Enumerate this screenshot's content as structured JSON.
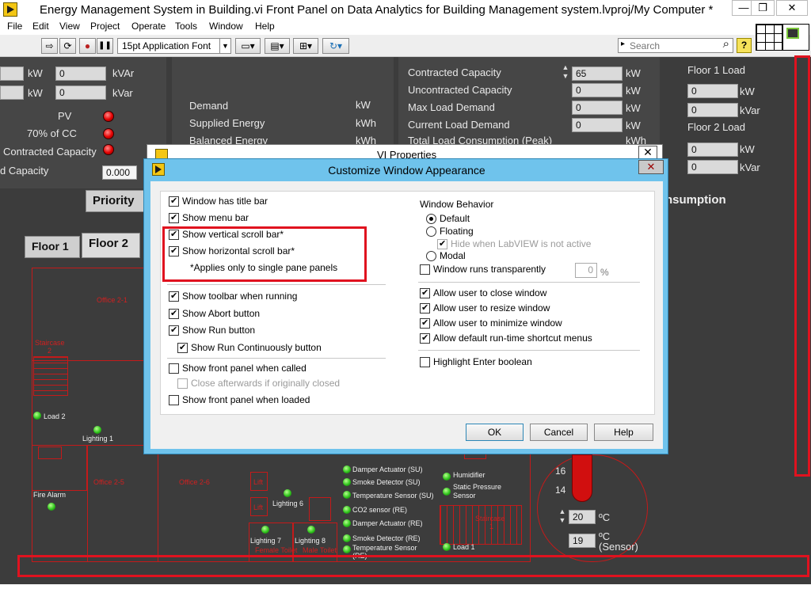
{
  "window": {
    "title": "Energy Management System in Building.vi Front Panel on Data Analytics for Building Management system.lvproj/My Computer *",
    "minimize": "—",
    "restore": "❐",
    "close": "✕"
  },
  "menu": [
    "File",
    "Edit",
    "View",
    "Project",
    "Operate",
    "Tools",
    "Window",
    "Help"
  ],
  "toolbar": {
    "run": "⇨",
    "run_continuously": "⟳",
    "abort": "●",
    "pause": "❚❚",
    "font": "15pt Application Font",
    "align": "▭▾",
    "distribute": "▤▾",
    "resize": "⊞▾",
    "reorder": "↻▾",
    "search_placeholder": "Search",
    "search_icon": "⌕",
    "help": "?"
  },
  "panel": {
    "left_top": {
      "r1_val1": "0",
      "r1_unit1": "kW",
      "r1_val2": "0",
      "r1_unit2": "kVAr",
      "r2_unit1": "kW",
      "r2_val2": "0",
      "r2_unit2": "kVar",
      "pv": "PV",
      "cc70": "70% of CC",
      "contracted": "Contracted Capacity",
      "d_capacity": "d Capacity",
      "d_capacity_val": "0.000"
    },
    "middle": {
      "demand": "Demand",
      "demand_unit": "kW",
      "supplied": "Supplied Energy",
      "supplied_unit": "kWh",
      "balanced": "Balanced Energy",
      "balanced_unit": "kWh"
    },
    "capacity": {
      "contracted": "Contracted Capacity",
      "contracted_val": "65",
      "contracted_unit": "kW",
      "uncontracted": "Uncontracted Capacity",
      "uncontracted_val": "0",
      "uncontracted_unit": "kW",
      "max_load": "Max Load Demand",
      "max_load_val": "0",
      "max_load_unit": "kW",
      "current_load": "Current Load Demand",
      "current_load_val": "0",
      "current_load_unit": "kW",
      "total_load": "Total Load Consumption (Peak)",
      "total_load_unit": "kWh"
    },
    "floors_load": {
      "floor1": "Floor 1 Load",
      "f1_kw": "0",
      "f1_kw_unit": "kW",
      "f1_kvar": "0",
      "f1_kvar_unit": "kVar",
      "floor2": "Floor 2 Load",
      "f2_kw": "0",
      "f2_kw_unit": "kW",
      "f2_kvar": "0",
      "f2_kvar_unit": "kVar"
    },
    "tabs": {
      "priority": "Priority",
      "consumption": "nsumption",
      "floor1": "Floor 1",
      "floor2": "Floor 2"
    },
    "plan": {
      "office21": "Office 2-1",
      "staircase": "Staircase",
      "staircase_num": "2",
      "load2": "Load 2",
      "lighting1": "Lighting 1",
      "fire_alarm": "Fire Alarm",
      "office25": "Office 2-5",
      "office26": "Office 2-6",
      "lift": "Lift",
      "lighting6": "Lighting 6",
      "lighting7": "Lighting 7",
      "lighting8": "Lighting 8",
      "female_toilet": "Female Toilet",
      "male_toilet": "Male Toilet",
      "damper_su": "Damper Actuator (SU)",
      "smoke_su": "Smoke Detector (SU)",
      "temp_su": "Temperature Sensor (SU)",
      "co2_re": "CO2 sensor (RE)",
      "damper_re": "Damper Actuator (RE)",
      "smoke_re": "Smoke Detector (RE)",
      "temp_re": "Temperature Sensor",
      "temp_re_2": "(RE)",
      "humidifier": "Humidifier",
      "static_pressure": "Static Pressure",
      "sensor": "Sensor",
      "staircase1": "Staircase",
      "staircase1_num": "1",
      "load1": "Load 1"
    },
    "thermo": {
      "tick16": "16",
      "tick14": "14",
      "setpoint": "20",
      "setpoint_unit": "ºC",
      "sensor_val": "19",
      "sensor_unit": "ºC",
      "sensor_label": "(Sensor)"
    }
  },
  "vi_properties": {
    "title": "VI Properties",
    "close": "✕"
  },
  "dialog": {
    "title": "Customize Window Appearance",
    "close": "✕",
    "left": [
      {
        "label": "Window has title bar",
        "checked": true
      },
      {
        "label": "Show menu bar",
        "checked": true
      },
      {
        "label": "Show vertical scroll bar*",
        "checked": true
      },
      {
        "label": "Show horizontal scroll bar*",
        "checked": true
      },
      {
        "label": "Show toolbar when running",
        "checked": true
      },
      {
        "label": "Show Abort button",
        "checked": true
      },
      {
        "label": "Show Run button",
        "checked": true
      },
      {
        "label": "Show Run Continuously button",
        "checked": true
      },
      {
        "label": "Show front panel when called",
        "checked": false
      },
      {
        "label": "Close afterwards if originally closed",
        "checked": false
      },
      {
        "label": "Show front panel when loaded",
        "checked": false
      }
    ],
    "note": "*Applies only to single pane panels",
    "behavior": {
      "heading": "Window Behavior",
      "default": "Default",
      "floating": "Floating",
      "hide_inactive": "Hide when LabVIEW is not active",
      "modal": "Modal",
      "transparent": "Window runs transparently",
      "transparency_value": "0",
      "transparency_unit": "%",
      "selected": "Default"
    },
    "right": [
      {
        "label": "Allow user to close window",
        "checked": true
      },
      {
        "label": "Allow user to resize window",
        "checked": true
      },
      {
        "label": "Allow user to minimize window",
        "checked": true
      },
      {
        "label": "Allow default run-time shortcut menus",
        "checked": true
      },
      {
        "label": "Highlight Enter boolean",
        "checked": false
      }
    ],
    "buttons": {
      "ok": "OK",
      "cancel": "Cancel",
      "help": "Help"
    }
  },
  "colors": {
    "highlight": "#e0121f",
    "dialog_frame": "#6fc3ec",
    "panel_bg": "#3c3c3c"
  }
}
